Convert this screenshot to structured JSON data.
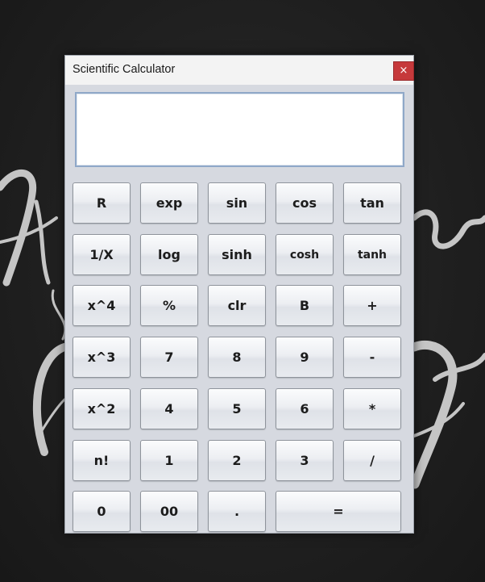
{
  "window": {
    "title": "Scientific Calculator",
    "close_label": "×"
  },
  "display": {
    "value": ""
  },
  "keys": {
    "r1": [
      "R",
      "exp",
      "sin",
      "cos",
      "tan"
    ],
    "r2": [
      "1/X",
      "log",
      "sinh",
      "cosh",
      "tanh"
    ],
    "r3": [
      "x^4",
      "%",
      "clr",
      "B",
      "+"
    ],
    "r4": [
      "x^3",
      "7",
      "8",
      "9",
      "-"
    ],
    "r5": [
      "x^2",
      "4",
      "5",
      "6",
      "*"
    ],
    "r6": [
      "n!",
      "1",
      "2",
      "3",
      "/"
    ],
    "r7": [
      "0",
      "00",
      ".",
      "="
    ]
  },
  "colors": {
    "close_button": "#c6393b",
    "window_body": "#d6d9e0",
    "display_border": "#8fa8c8"
  }
}
